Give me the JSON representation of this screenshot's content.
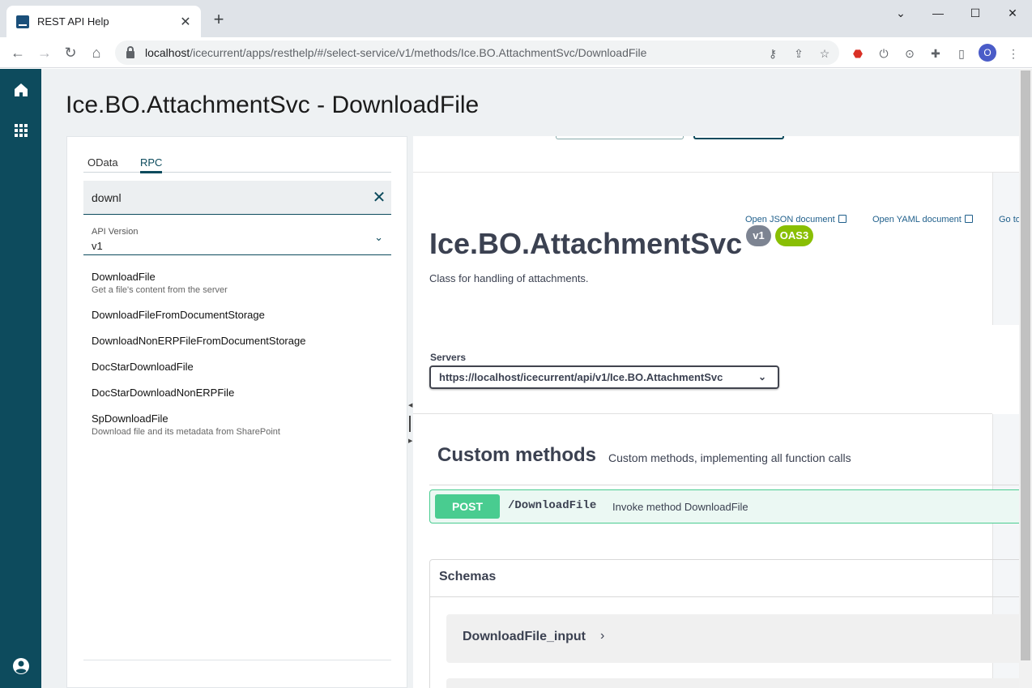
{
  "browser": {
    "tab_title": "REST API Help",
    "new_tab": "+",
    "url_host": "localhost",
    "url_path": "/icecurrent/apps/resthelp/#/select-service/v1/methods/Ice.BO.AttachmentSvc/DownloadFile",
    "profile_initial": "O"
  },
  "page": {
    "title": "Ice.BO.AttachmentSvc - DownloadFile"
  },
  "left_panel": {
    "tabs": [
      {
        "label": "OData"
      },
      {
        "label": "RPC"
      }
    ],
    "search": {
      "value": "downl"
    },
    "api_version": {
      "label": "API Version",
      "value": "v1"
    },
    "methods": [
      {
        "name": "DownloadFile",
        "description": "Get a file's content from the server"
      },
      {
        "name": "DownloadFileFromDocumentStorage",
        "description": ""
      },
      {
        "name": "DownloadNonERPFileFromDocumentStorage",
        "description": ""
      },
      {
        "name": "DocStarDownloadFile",
        "description": ""
      },
      {
        "name": "DocStarDownloadNonERPFile",
        "description": ""
      },
      {
        "name": "SpDownloadFile",
        "description": "Download file and its metadata from SharePoint"
      }
    ]
  },
  "swagger": {
    "links": {
      "json": "Open JSON document",
      "yaml": "Open YAML document",
      "goto": "Go to"
    },
    "service_name": "Ice.BO.AttachmentSvc",
    "badges": {
      "version": "v1",
      "oas": "OAS3"
    },
    "description": "Class for handling of attachments.",
    "servers_label": "Servers",
    "server_url": "https://localhost/icecurrent/api/v1/Ice.BO.AttachmentSvc",
    "section": {
      "title": "Custom methods",
      "description": "Custom methods, implementing all function calls"
    },
    "operation": {
      "method": "POST",
      "path": "/DownloadFile",
      "summary": "Invoke method DownloadFile"
    },
    "schemas": {
      "header": "Schemas",
      "items": [
        "DownloadFile_input"
      ]
    }
  },
  "colors": {
    "rail": "#0d4b5d",
    "post": "#49cc90",
    "badge_version": "#7d8492",
    "badge_oas": "#89bf04"
  }
}
